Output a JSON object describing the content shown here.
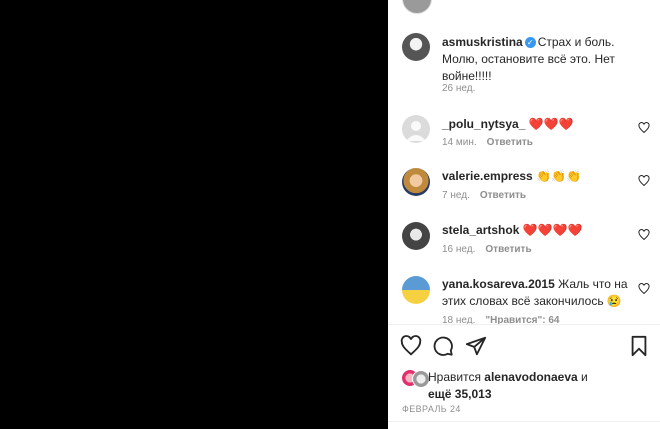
{
  "caption": {
    "username": "asmuskristina",
    "text": "Страх и боль. Молю, остановите всё это. Нет войне!!!!!",
    "time": "26 нед."
  },
  "comments": [
    {
      "username": "_polu_nytsya_",
      "text": "❤️❤️❤️",
      "time": "14 мин.",
      "reply": "Ответить"
    },
    {
      "username": "valerie.empress",
      "text": "👏👏👏",
      "time": "7 нед.",
      "reply": "Ответить"
    },
    {
      "username": "stela_artshok",
      "text": "❤️❤️❤️❤️",
      "time": "16 нед.",
      "reply": "Ответить"
    },
    {
      "username": "yana.kosareva.2015",
      "text": "Жаль что на этих словах всё закончилось 😢",
      "time": "18 нед.",
      "likes": "\"Нравится\": 64"
    }
  ],
  "likes": {
    "prefix": "Нравится",
    "user": "alenavodonaeva",
    "conj": "и",
    "more": "ещё 35,013"
  },
  "date": "ФЕВРАЛЬ 24",
  "colors": {
    "heart": "#ed4956",
    "verified": "#3897f0",
    "muted": "#8e8e8e"
  }
}
